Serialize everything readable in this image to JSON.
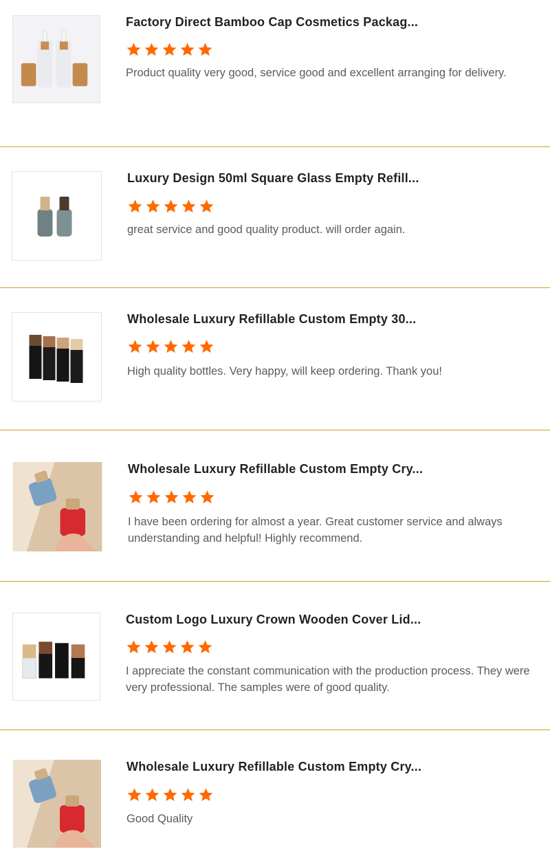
{
  "colors": {
    "star": "#ff6a00",
    "divider": "#c9a227",
    "title": "#222222",
    "comment": "#5b5b5b"
  },
  "reviews": [
    {
      "title": "Factory Direct Bamboo Cap Cosmetics Packag...",
      "rating": 5,
      "comment": "Product quality very good, service good and excellent arranging for delivery.",
      "image": "frosted-dropper-bottles-bamboo-caps"
    },
    {
      "title": "Luxury Design 50ml Square Glass Empty Refill...",
      "rating": 5,
      "comment": "great service and good quality product. will order again.",
      "image": "grey-glass-bottles-wooden-caps"
    },
    {
      "title": "Wholesale Luxury Refillable Custom Empty 30...",
      "rating": 5,
      "comment": "High quality bottles. Very happy, will keep ordering. Thank you!",
      "image": "black-boxes-wooden-lids"
    },
    {
      "title": "Wholesale Luxury Refillable Custom Empty Cry...",
      "rating": 5,
      "comment": "I have been ordering for almost a year. Great customer service and always understanding and helpful! Highly recommend.",
      "image": "hand-holding-red-and-blue-bottles"
    },
    {
      "title": "Custom Logo Luxury Crown Wooden Cover Lid...",
      "rating": 5,
      "comment": "I appreciate the constant communication with the production process. They were very professional. The samples were of good quality.",
      "image": "bottle-set-clear-black-wooden-caps"
    },
    {
      "title": "Wholesale Luxury Refillable Custom Empty Cry...",
      "rating": 5,
      "comment": "Good Quality",
      "image": "hand-holding-red-and-blue-bottles"
    }
  ]
}
